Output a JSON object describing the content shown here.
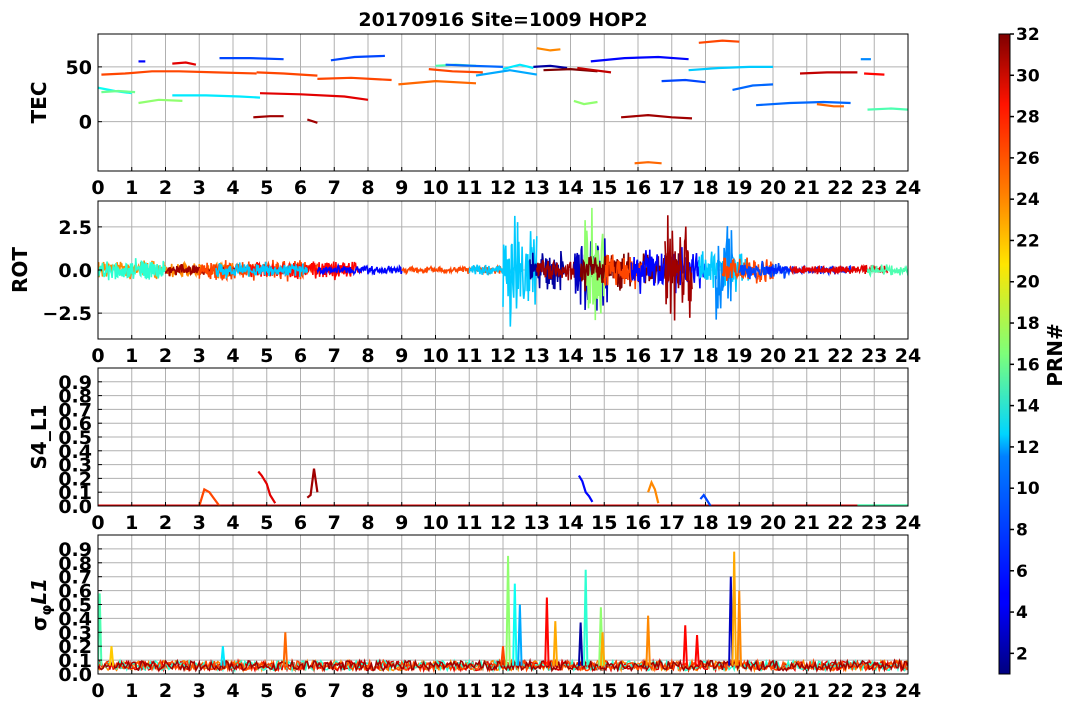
{
  "figure": {
    "title": "20170916 Site=1009 HOP2"
  },
  "colorbar": {
    "label": "PRN#",
    "range": [
      1,
      32
    ],
    "ticks": [
      "2",
      "4",
      "6",
      "8",
      "10",
      "12",
      "14",
      "16",
      "18",
      "20",
      "22",
      "24",
      "26",
      "28",
      "30",
      "32"
    ],
    "colormap": "jet"
  },
  "chart_data": [
    {
      "type": "line",
      "panel": "tec",
      "ylabel": "TEC",
      "xlim": [
        0,
        24
      ],
      "ylim": [
        -45,
        80
      ],
      "xticks": [
        "0",
        "1",
        "2",
        "3",
        "4",
        "5",
        "6",
        "7",
        "8",
        "9",
        "10",
        "11",
        "12",
        "13",
        "14",
        "15",
        "16",
        "17",
        "18",
        "19",
        "20",
        "21",
        "22",
        "23",
        "24"
      ],
      "yticks": [
        "50",
        "0"
      ],
      "ytick_values": [
        50,
        0
      ],
      "grid": true,
      "series": [
        {
          "prn": 26,
          "x": [
            0.1,
            0.8,
            1.6,
            2.4,
            3.5,
            4.7
          ],
          "y": [
            43,
            44,
            46,
            46,
            45,
            44
          ]
        },
        {
          "prn": 26,
          "x": [
            4.7,
            5.5,
            6.5
          ],
          "y": [
            45,
            44,
            42
          ]
        },
        {
          "prn": 13,
          "x": [
            0.0,
            0.5,
            1.0
          ],
          "y": [
            31,
            28,
            26
          ]
        },
        {
          "prn": 16,
          "x": [
            0.1,
            0.6,
            1.1
          ],
          "y": [
            27,
            28,
            27
          ]
        },
        {
          "prn": 17,
          "x": [
            1.2,
            1.8,
            2.5
          ],
          "y": [
            17,
            20,
            19
          ]
        },
        {
          "prn": 12,
          "x": [
            2.2,
            3.2,
            4.2,
            4.8
          ],
          "y": [
            24,
            24,
            23,
            22
          ]
        },
        {
          "prn": 29,
          "x": [
            2.2,
            2.6,
            2.9
          ],
          "y": [
            53,
            54,
            52
          ]
        },
        {
          "prn": 5,
          "x": [
            1.2,
            1.4
          ],
          "y": [
            55,
            55
          ]
        },
        {
          "prn": 7,
          "x": [
            3.6,
            4.5,
            5.5
          ],
          "y": [
            58,
            58,
            57
          ]
        },
        {
          "prn": 29,
          "x": [
            4.8,
            6.0,
            7.3,
            8.0
          ],
          "y": [
            26,
            25,
            23,
            20
          ]
        },
        {
          "prn": 31,
          "x": [
            4.6,
            5.1,
            5.5
          ],
          "y": [
            4,
            5,
            5
          ]
        },
        {
          "prn": 31,
          "x": [
            6.2,
            6.5
          ],
          "y": [
            2,
            -1
          ]
        },
        {
          "prn": 26,
          "x": [
            6.5,
            7.5,
            8.7
          ],
          "y": [
            39,
            40,
            38
          ]
        },
        {
          "prn": 7,
          "x": [
            6.9,
            7.6,
            8.5
          ],
          "y": [
            56,
            59,
            60
          ]
        },
        {
          "prn": 25,
          "x": [
            8.9,
            10.0,
            11.2
          ],
          "y": [
            34,
            37,
            35
          ]
        },
        {
          "prn": 15,
          "x": [
            10.0,
            10.6,
            11.2
          ],
          "y": [
            51,
            52,
            51
          ]
        },
        {
          "prn": 26,
          "x": [
            9.8,
            10.5,
            11.4
          ],
          "y": [
            48,
            46,
            45
          ]
        },
        {
          "prn": 8,
          "x": [
            10.3,
            11.1,
            12.0
          ],
          "y": [
            52,
            51,
            50
          ]
        },
        {
          "prn": 10,
          "x": [
            11.2,
            12.2,
            13.0
          ],
          "y": [
            42,
            47,
            43
          ]
        },
        {
          "prn": 12,
          "x": [
            12.0,
            12.5,
            12.9
          ],
          "y": [
            48,
            52,
            49
          ]
        },
        {
          "prn": 2,
          "x": [
            12.9,
            13.4,
            13.9
          ],
          "y": [
            50,
            51,
            49
          ]
        },
        {
          "prn": 24,
          "x": [
            13.0,
            13.4,
            13.7
          ],
          "y": [
            67,
            65,
            66
          ]
        },
        {
          "prn": 32,
          "x": [
            13.2,
            14.0,
            14.8
          ],
          "y": [
            47,
            48,
            46
          ]
        },
        {
          "prn": 30,
          "x": [
            14.2,
            14.7,
            15.2
          ],
          "y": [
            49,
            47,
            45
          ]
        },
        {
          "prn": 5,
          "x": [
            14.6,
            15.6,
            16.6,
            17.5
          ],
          "y": [
            55,
            58,
            59,
            57
          ]
        },
        {
          "prn": 17,
          "x": [
            14.1,
            14.4,
            14.8
          ],
          "y": [
            19,
            16,
            18
          ]
        },
        {
          "prn": 31,
          "x": [
            15.5,
            16.3,
            17.0,
            17.6
          ],
          "y": [
            4,
            6,
            4,
            3
          ]
        },
        {
          "prn": 25,
          "x": [
            15.9,
            16.3,
            16.7
          ],
          "y": [
            -38,
            -37,
            -38
          ]
        },
        {
          "prn": 7,
          "x": [
            16.7,
            17.4,
            18.0
          ],
          "y": [
            37,
            38,
            36
          ]
        },
        {
          "prn": 11,
          "x": [
            17.5,
            18.4,
            19.3,
            20.0
          ],
          "y": [
            47,
            49,
            50,
            50
          ]
        },
        {
          "prn": 26,
          "x": [
            17.8,
            18.5,
            19.0
          ],
          "y": [
            72,
            74,
            73
          ]
        },
        {
          "prn": 8,
          "x": [
            18.8,
            19.4,
            20.0
          ],
          "y": [
            29,
            33,
            34
          ]
        },
        {
          "prn": 8,
          "x": [
            19.5,
            20.5,
            21.5,
            22.3
          ],
          "y": [
            15,
            17,
            18,
            17
          ]
        },
        {
          "prn": 30,
          "x": [
            20.8,
            21.6,
            22.5
          ],
          "y": [
            44,
            45,
            45
          ]
        },
        {
          "prn": 28,
          "x": [
            22.7,
            23.3
          ],
          "y": [
            44,
            43
          ]
        },
        {
          "prn": 25,
          "x": [
            21.3,
            21.8,
            22.1
          ],
          "y": [
            16,
            14,
            14
          ]
        },
        {
          "prn": 9,
          "x": [
            22.6,
            22.9
          ],
          "y": [
            57,
            57
          ]
        },
        {
          "prn": 15,
          "x": [
            22.8,
            23.5,
            24.0
          ],
          "y": [
            11,
            12,
            11
          ]
        }
      ]
    },
    {
      "type": "line",
      "panel": "rot",
      "ylabel": "ROT",
      "xlim": [
        0,
        24
      ],
      "ylim": [
        -4,
        4
      ],
      "xticks": [
        "0",
        "1",
        "2",
        "3",
        "4",
        "5",
        "6",
        "7",
        "8",
        "9",
        "10",
        "11",
        "12",
        "13",
        "14",
        "15",
        "16",
        "17",
        "18",
        "19",
        "20",
        "21",
        "22",
        "23",
        "24"
      ],
      "yticks": [
        "2.5",
        "0.0",
        "−2.5"
      ],
      "ytick_values": [
        2.5,
        0.0,
        -2.5
      ],
      "grid": true,
      "series": [
        {
          "prn": 24,
          "x": [
            0.0,
            4.0
          ],
          "amp": 0.6,
          "seed": 1
        },
        {
          "prn": 14,
          "x": [
            0.0,
            2.0
          ],
          "amp": 0.7,
          "seed": 2
        },
        {
          "prn": 31,
          "x": [
            2.0,
            4.2
          ],
          "amp": 0.4,
          "seed": 3
        },
        {
          "prn": 26,
          "x": [
            3.0,
            6.5
          ],
          "amp": 0.7,
          "seed": 4
        },
        {
          "prn": 28,
          "x": [
            4.5,
            7.8
          ],
          "amp": 0.6,
          "seed": 5
        },
        {
          "prn": 11,
          "x": [
            3.5,
            6.2
          ],
          "amp": 0.5,
          "seed": 6
        },
        {
          "prn": 5,
          "x": [
            6.5,
            9.0
          ],
          "amp": 0.3,
          "seed": 7
        },
        {
          "prn": 26,
          "x": [
            9.0,
            12.0
          ],
          "amp": 0.25,
          "seed": 8
        },
        {
          "prn": 11,
          "x": [
            11.0,
            12.3
          ],
          "amp": 0.4,
          "seed": 9
        },
        {
          "prn": 11,
          "x": [
            12.0,
            13.0
          ],
          "amp": 3.8,
          "seed": 10
        },
        {
          "prn": 2,
          "x": [
            12.8,
            13.8
          ],
          "amp": 1.5,
          "seed": 11
        },
        {
          "prn": 31,
          "x": [
            13.0,
            14.4
          ],
          "amp": 0.8,
          "seed": 12
        },
        {
          "prn": 3,
          "x": [
            14.1,
            15.1
          ],
          "amp": 2.6,
          "seed": 13
        },
        {
          "prn": 17,
          "x": [
            14.4,
            15.0
          ],
          "amp": 3.8,
          "seed": 14
        },
        {
          "prn": 32,
          "x": [
            14.3,
            17.2
          ],
          "amp": 1.3,
          "seed": 15
        },
        {
          "prn": 26,
          "x": [
            15.0,
            16.2
          ],
          "amp": 1.2,
          "seed": 16
        },
        {
          "prn": 5,
          "x": [
            15.8,
            18.0
          ],
          "amp": 1.5,
          "seed": 17
        },
        {
          "prn": 31,
          "x": [
            16.8,
            17.6
          ],
          "amp": 3.6,
          "seed": 18
        },
        {
          "prn": 11,
          "x": [
            17.8,
            19.3
          ],
          "amp": 1.4,
          "seed": 19
        },
        {
          "prn": 9,
          "x": [
            18.3,
            18.8
          ],
          "amp": 3.8,
          "seed": 20
        },
        {
          "prn": 26,
          "x": [
            18.5,
            20.0
          ],
          "amp": 0.9,
          "seed": 21
        },
        {
          "prn": 7,
          "x": [
            19.0,
            20.5
          ],
          "amp": 0.6,
          "seed": 22
        },
        {
          "prn": 6,
          "x": [
            19.8,
            22.3
          ],
          "amp": 0.3,
          "seed": 23
        },
        {
          "prn": 29,
          "x": [
            20.5,
            23.4
          ],
          "amp": 0.3,
          "seed": 24
        },
        {
          "prn": 15,
          "x": [
            22.8,
            24.0
          ],
          "amp": 0.35,
          "seed": 25
        }
      ]
    },
    {
      "type": "line",
      "panel": "s4",
      "ylabel": "S4_L1",
      "xlim": [
        0,
        24
      ],
      "ylim": [
        0,
        1
      ],
      "xticks": [
        "0",
        "1",
        "2",
        "3",
        "4",
        "5",
        "6",
        "7",
        "8",
        "9",
        "10",
        "11",
        "12",
        "13",
        "14",
        "15",
        "16",
        "17",
        "18",
        "19",
        "20",
        "21",
        "22",
        "23",
        "24"
      ],
      "yticks": [
        "0.9",
        "0.8",
        "0.7",
        "0.6",
        "0.5",
        "0.4",
        "0.3",
        "0.2",
        "0.1",
        "0.0"
      ],
      "ytick_values": [
        0.9,
        0.8,
        0.7,
        0.6,
        0.5,
        0.4,
        0.3,
        0.2,
        0.1,
        0.0
      ],
      "grid": true,
      "series": [
        {
          "prn": 29,
          "x": [
            0.0,
            24.0
          ],
          "y": [
            0.003,
            0.003
          ]
        },
        {
          "prn": 26,
          "x": [
            3.0,
            3.15,
            3.3,
            3.45,
            3.6
          ],
          "y": [
            0.0,
            0.12,
            0.1,
            0.05,
            0.0
          ]
        },
        {
          "prn": 29,
          "x": [
            4.75,
            4.85,
            5.0,
            5.1,
            5.25
          ],
          "y": [
            0.25,
            0.22,
            0.16,
            0.08,
            0.02
          ]
        },
        {
          "prn": 31,
          "x": [
            6.2,
            6.3,
            6.4,
            6.5
          ],
          "y": [
            0.06,
            0.08,
            0.27,
            0.1
          ]
        },
        {
          "prn": 5,
          "x": [
            14.25,
            14.35,
            14.45,
            14.55,
            14.65
          ],
          "y": [
            0.22,
            0.18,
            0.1,
            0.07,
            0.03
          ]
        },
        {
          "prn": 24,
          "x": [
            16.3,
            16.4,
            16.5,
            16.6
          ],
          "y": [
            0.1,
            0.17,
            0.12,
            0.02
          ]
        },
        {
          "prn": 7,
          "x": [
            17.85,
            17.95,
            18.05,
            18.15
          ],
          "y": [
            0.05,
            0.08,
            0.04,
            0.0
          ]
        },
        {
          "prn": 15,
          "x": [
            22.5,
            24.0
          ],
          "y": [
            0.005,
            0.005
          ]
        }
      ]
    },
    {
      "type": "line",
      "panel": "sigma",
      "ylabel": "σφL1",
      "xlim": [
        0,
        24
      ],
      "ylim": [
        0,
        1
      ],
      "xticks": [
        "0",
        "1",
        "2",
        "3",
        "4",
        "5",
        "6",
        "7",
        "8",
        "9",
        "10",
        "11",
        "12",
        "13",
        "14",
        "15",
        "16",
        "17",
        "18",
        "19",
        "20",
        "21",
        "22",
        "23",
        "24"
      ],
      "yticks": [
        "0.9",
        "0.8",
        "0.7",
        "0.6",
        "0.5",
        "0.4",
        "0.3",
        "0.2",
        "0.1",
        "0.0"
      ],
      "ytick_values": [
        0.9,
        0.8,
        0.7,
        0.6,
        0.5,
        0.4,
        0.3,
        0.2,
        0.1,
        0.0
      ],
      "grid": true,
      "baseline": 0.06,
      "spikes": [
        {
          "prn": 15,
          "x": 0.05,
          "y": 0.58
        },
        {
          "prn": 22,
          "x": 0.4,
          "y": 0.2
        },
        {
          "prn": 12,
          "x": 3.7,
          "y": 0.2
        },
        {
          "prn": 25,
          "x": 5.55,
          "y": 0.3
        },
        {
          "prn": 26,
          "x": 12.0,
          "y": 0.2
        },
        {
          "prn": 17,
          "x": 12.15,
          "y": 0.85
        },
        {
          "prn": 13,
          "x": 12.35,
          "y": 0.65
        },
        {
          "prn": 10,
          "x": 12.5,
          "y": 0.5
        },
        {
          "prn": 28,
          "x": 13.3,
          "y": 0.55
        },
        {
          "prn": 23,
          "x": 13.55,
          "y": 0.38
        },
        {
          "prn": 2,
          "x": 14.3,
          "y": 0.37
        },
        {
          "prn": 14,
          "x": 14.45,
          "y": 0.75
        },
        {
          "prn": 17,
          "x": 14.9,
          "y": 0.48
        },
        {
          "prn": 23,
          "x": 14.95,
          "y": 0.3
        },
        {
          "prn": 24,
          "x": 16.3,
          "y": 0.42
        },
        {
          "prn": 28,
          "x": 17.4,
          "y": 0.35
        },
        {
          "prn": 28,
          "x": 17.75,
          "y": 0.28
        },
        {
          "prn": 3,
          "x": 18.75,
          "y": 0.7
        },
        {
          "prn": 23,
          "x": 18.85,
          "y": 0.88
        },
        {
          "prn": 24,
          "x": 19.0,
          "y": 0.6
        }
      ]
    }
  ]
}
